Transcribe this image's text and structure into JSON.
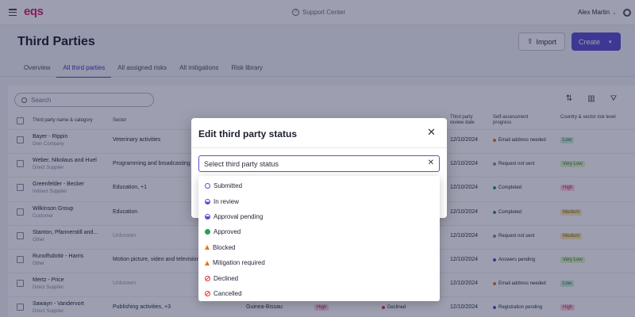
{
  "topbar": {
    "logo": "eqs",
    "support_label": "Support Center",
    "user_name": "Alex Martin"
  },
  "page": {
    "title": "Third Parties",
    "import_label": "Import",
    "create_label": "Create",
    "tabs": [
      {
        "label": "Overview"
      },
      {
        "label": "All third parties"
      },
      {
        "label": "All assigned risks"
      },
      {
        "label": "All mitigations"
      },
      {
        "label": "Risk library"
      }
    ]
  },
  "table": {
    "search_placeholder": "Search",
    "headers": {
      "name": "Third party name & category",
      "sector": "Sector",
      "review_date": "Third party review date",
      "progress": "Self-assessment progress",
      "risk_level": "Country & sector risk level"
    },
    "rows": [
      {
        "name": "Bayer - Rippin",
        "category": "Own Company",
        "sector": "Veterinary activities",
        "date": "12/10/2024",
        "progress": "Email address needed",
        "progress_color": "#e07a1a",
        "risk": "Low",
        "risk_bg": "#cdeed6",
        "risk_fg": "#237a3e"
      },
      {
        "name": "Weber, Nikolaus and Huel",
        "category": "Direct Supplier",
        "sector": "Programming and broadcasting",
        "date": "12/10/2024",
        "progress": "Request not sent",
        "progress_color": "#8a8ea0",
        "risk": "Very Low",
        "risk_bg": "#dff5c9",
        "risk_fg": "#3f7a1e"
      },
      {
        "name": "Greenfelder - Becker",
        "category": "Indirect Supplier",
        "sector": "Education, +1",
        "date": "12/10/2024",
        "progress": "Completed",
        "progress_color": "#2e9e4f",
        "risk": "High",
        "risk_bg": "#fbd3df",
        "risk_fg": "#b3244f"
      },
      {
        "name": "Wilkinson Group",
        "category": "Customer",
        "sector": "Education",
        "date": "12/10/2024",
        "progress": "Completed",
        "progress_color": "#2e9e4f",
        "risk": "Medium",
        "risk_bg": "#fde9b3",
        "risk_fg": "#8a6200"
      },
      {
        "name": "Stanton, Pfannerstill and...",
        "category": "Other",
        "sector": "Unknown",
        "sector_muted": true,
        "date": "12/10/2024",
        "progress": "Request not sent",
        "progress_color": "#8a8ea0",
        "risk": "Medium",
        "risk_bg": "#fde9b3",
        "risk_fg": "#8a6200"
      },
      {
        "name": "Runolfsdottir - Harris",
        "category": "Other",
        "sector": "Motion picture, video and television",
        "date": "12/10/2024",
        "progress": "Answers pending",
        "progress_color": "#5a4fcf",
        "risk": "Very Low",
        "risk_bg": "#dff5c9",
        "risk_fg": "#3f7a1e"
      },
      {
        "name": "Mertz - Price",
        "category": "Direct Supplier",
        "sector": "Unknown",
        "sector_muted": true,
        "date": "12/10/2024",
        "progress": "Email address needed",
        "progress_color": "#e07a1a",
        "risk": "Low",
        "risk_bg": "#cdeed6",
        "risk_fg": "#237a3e"
      },
      {
        "name": "Sawayn - Vandervort",
        "category": "Direct Supplier",
        "sector": "Publishing activities, +3",
        "date": "12/10/2024",
        "progress": "Registration pending",
        "progress_color": "#5a4fcf",
        "risk": "High",
        "risk_bg": "#fbd3df",
        "risk_fg": "#b3244f",
        "country": "Guinea-Bissau",
        "country_risk": "High",
        "status": "Declined"
      }
    ]
  },
  "modal": {
    "title": "Edit third party status",
    "select_placeholder": "Select third party status",
    "options": [
      {
        "label": "Submitted",
        "icon": "submitted-icon"
      },
      {
        "label": "In review",
        "icon": "in-review-icon"
      },
      {
        "label": "Approval pending",
        "icon": "approval-pending-icon"
      },
      {
        "label": "Approved",
        "icon": "approved-icon"
      },
      {
        "label": "Blocked",
        "icon": "warning-triangle-icon"
      },
      {
        "label": "Mitigation required",
        "icon": "warning-triangle-icon"
      },
      {
        "label": "Declined",
        "icon": "declined-icon"
      },
      {
        "label": "Cancelled",
        "icon": "cancelled-icon"
      }
    ]
  },
  "colors": {
    "accent": "#5a4fcf",
    "brand": "#d6246e",
    "overlay": "rgba(22, 26, 66, 0.42)"
  }
}
